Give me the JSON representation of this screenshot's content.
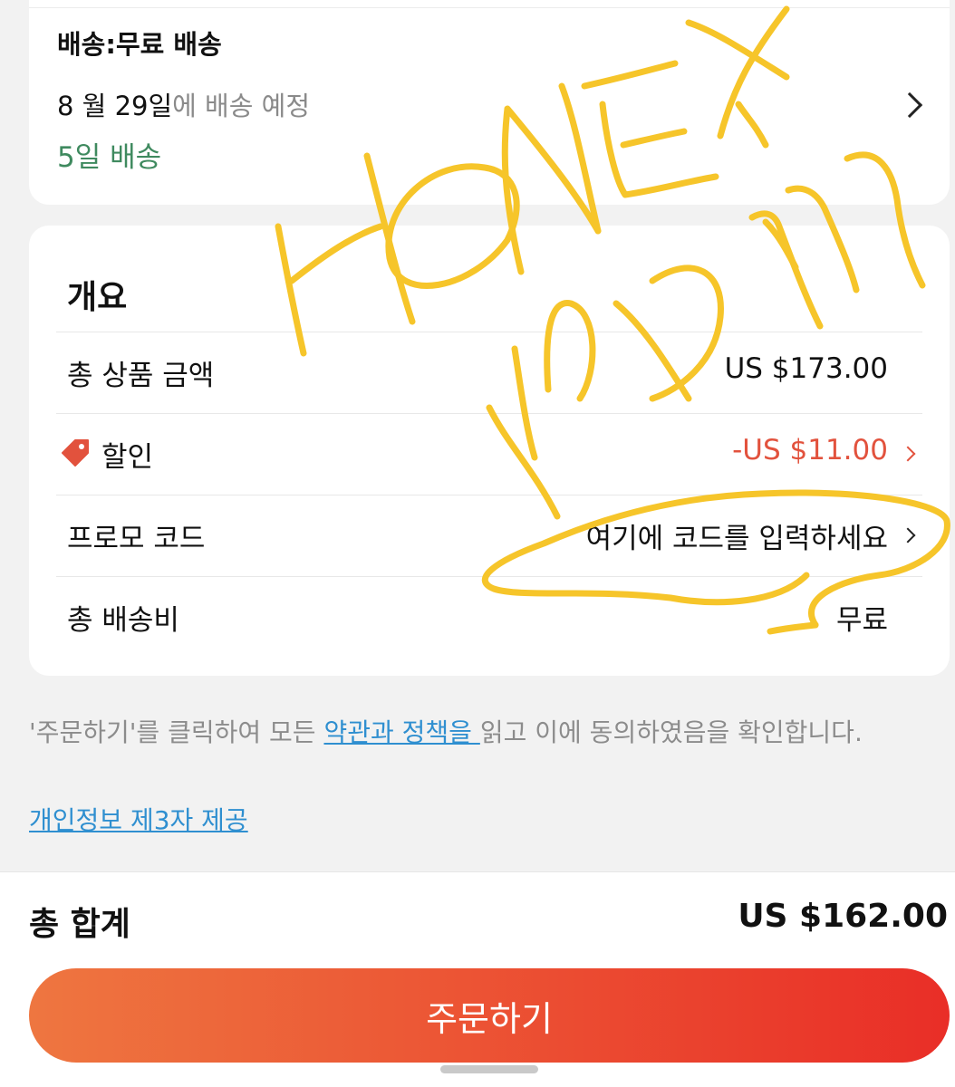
{
  "shipping": {
    "title": "배송:무료 배송",
    "date": "8 월 29일",
    "date_suffix": "에 배송 예정",
    "days": "5일 배송"
  },
  "summary": {
    "title": "개요",
    "subtotal_label": "총 상품 금액",
    "subtotal_value": "US $173.00",
    "discount_label": "할인",
    "discount_value": "-US $11.00",
    "promo_label": "프로모 코드",
    "promo_value": "여기에 코드를 입력하세요",
    "shipping_label": "총 배송비",
    "shipping_value": "무료"
  },
  "notice": {
    "prefix": "'주문하기'를 클릭하여 모든 ",
    "link": "약관과 정책을 ",
    "suffix": "읽고 이에 동의하였음을 확인합니다.",
    "privacy_link": "개인정보 제3자 제공"
  },
  "footer": {
    "total_label": "총 합계",
    "total_value": "US $162.00",
    "order_button": "주문하기"
  },
  "colors": {
    "accent_start": "#ee7640",
    "accent_end": "#e92e27",
    "discount": "#e2523d",
    "delivery_green": "#3f8a5f",
    "link": "#2f8fd0",
    "handwriting": "#f6c52a"
  },
  "icons": [
    "chevron-right-icon",
    "price-tag-icon"
  ]
}
